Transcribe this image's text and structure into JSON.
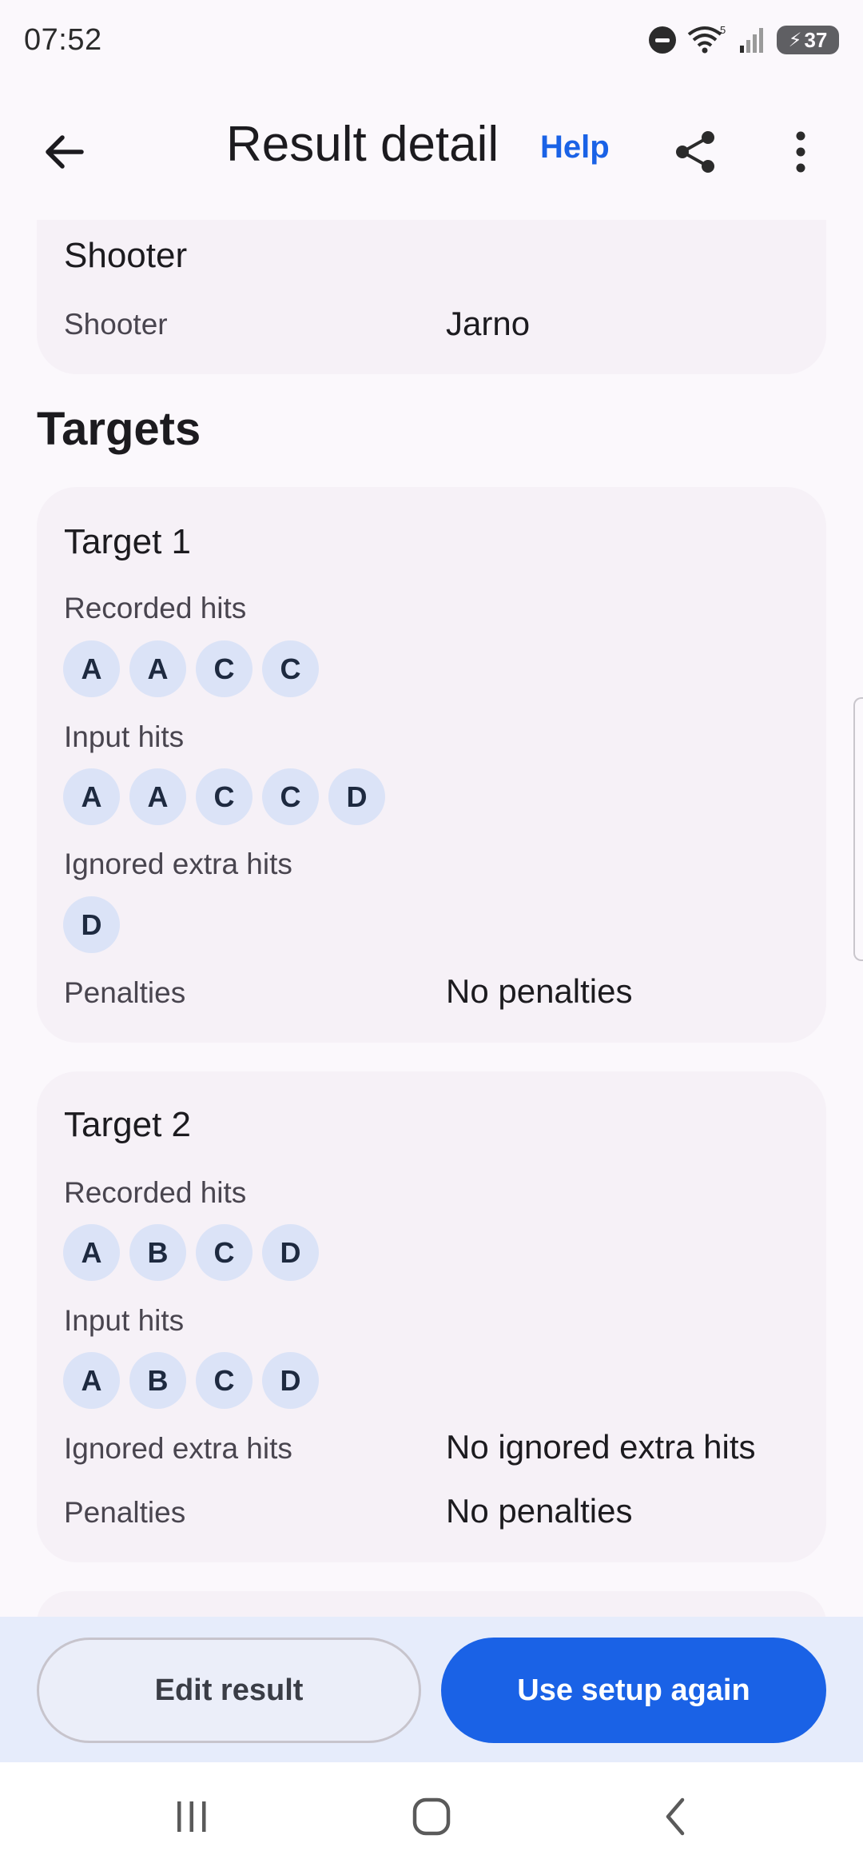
{
  "status_bar": {
    "time": "07:52",
    "battery": "37",
    "wifi_badge": "5"
  },
  "app_bar": {
    "title": "Result detail",
    "help": "Help",
    "icons": [
      "arrow-back-icon",
      "share-icon",
      "more-vert-icon"
    ]
  },
  "shooter_card": {
    "title": "Shooter",
    "label": "Shooter",
    "value": "Jarno"
  },
  "targets_title": "Targets",
  "targets": [
    {
      "title": "Target 1",
      "recorded_label": "Recorded hits",
      "recorded": [
        "A",
        "A",
        "C",
        "C"
      ],
      "input_label": "Input hits",
      "input": [
        "A",
        "A",
        "C",
        "C",
        "D"
      ],
      "ignored_label": "Ignored extra hits",
      "ignored": [
        "D"
      ],
      "penalties_label": "Penalties",
      "penalties_value": "No penalties"
    },
    {
      "title": "Target 2",
      "recorded_label": "Recorded hits",
      "recorded": [
        "A",
        "B",
        "C",
        "D"
      ],
      "input_label": "Input hits",
      "input": [
        "A",
        "B",
        "C",
        "D"
      ],
      "ignored_label": "Ignored extra hits",
      "ignored_value": "No ignored extra hits",
      "penalties_label": "Penalties",
      "penalties_value": "No penalties"
    }
  ],
  "actions": {
    "edit": "Edit result",
    "use_again": "Use setup again"
  },
  "colors": {
    "accent": "#1a62e6",
    "chip_bg": "#dbe3f7",
    "card_bg": "#f6f1f7"
  }
}
